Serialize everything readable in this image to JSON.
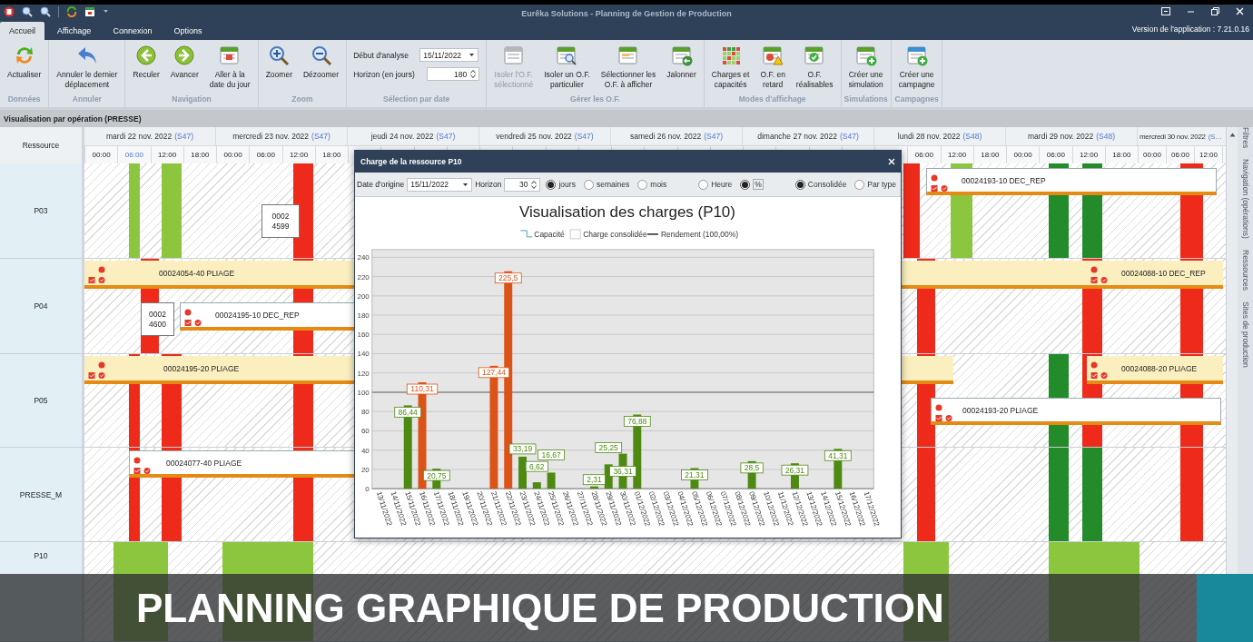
{
  "window": {
    "title": "Eurêka Solutions - Planning de Gestion de Production"
  },
  "tabs": [
    {
      "label": "Accueil",
      "selected": true
    },
    {
      "label": "Affichage",
      "selected": false
    },
    {
      "label": "Connexion",
      "selected": false
    },
    {
      "label": "Options",
      "selected": false
    }
  ],
  "version": "Version de l'application : 7.21.0.16",
  "ribbon": {
    "groups": [
      {
        "title": "Données",
        "buttons": [
          {
            "label": "Actualiser",
            "disabled": false
          }
        ]
      },
      {
        "title": "Annuler",
        "buttons": [
          {
            "label": "Annuler le dernier\ndéplacement",
            "disabled": false
          }
        ]
      },
      {
        "title": "Navigation",
        "buttons": [
          {
            "label": "Reculer",
            "disabled": false
          },
          {
            "label": "Avancer",
            "disabled": false
          },
          {
            "label": "Aller à la\ndate du jour",
            "disabled": false
          }
        ]
      },
      {
        "title": "Zoom",
        "buttons": [
          {
            "label": "Zoomer",
            "disabled": false
          },
          {
            "label": "Dézoomer",
            "disabled": false
          }
        ]
      },
      {
        "title": "Sélection par date",
        "fields": [
          {
            "label": "Début d'analyse",
            "value": "15/11/2022",
            "kind": "date"
          },
          {
            "label": "Horizon (en jours)",
            "value": "180",
            "kind": "spin"
          }
        ]
      },
      {
        "title": "Gérer les O.F.",
        "buttons": [
          {
            "label": "Isoler l'O.F.\nsélectionné",
            "disabled": true
          },
          {
            "label": "Isoler un O.F.\nparticulier",
            "disabled": false
          },
          {
            "label": "Sélectionner les\nO.F. à afficher",
            "disabled": false
          },
          {
            "label": "Jalonner",
            "disabled": false
          }
        ]
      },
      {
        "title": "Modes d'affichage",
        "buttons": [
          {
            "label": "Charges et\ncapacités",
            "disabled": false
          },
          {
            "label": "O.F. en\nretard",
            "disabled": false
          },
          {
            "label": "O.F.\nréalisables",
            "disabled": false
          }
        ]
      },
      {
        "title": "Simulations",
        "buttons": [
          {
            "label": "Créer une\nsimulation",
            "disabled": false
          }
        ]
      },
      {
        "title": "Campagnes",
        "buttons": [
          {
            "label": "Créer une\ncampagne",
            "disabled": false
          }
        ]
      }
    ]
  },
  "section_title": "Visualisation par opération (PRESSE)",
  "gantt": {
    "resource_header": "Ressource",
    "days": [
      {
        "date": "mardi 22 nov. 2022",
        "week": "(S47)",
        "hours": [
          "00:00",
          "06:00",
          "12:00",
          "18:00"
        ]
      },
      {
        "date": "mercredi 23 nov. 2022",
        "week": "(S47)",
        "hours": [
          "00:00",
          "06:00",
          "12:00",
          "18:00"
        ]
      },
      {
        "date": "jeudi 24 nov. 2022",
        "week": "(S47)"
      },
      {
        "date": "vendredi 25 nov. 2022",
        "week": "(S47)"
      },
      {
        "date": "samedi 26 nov. 2022",
        "week": "(S47)"
      },
      {
        "date": "dimanche 27 nov. 2022",
        "week": "(S47)"
      },
      {
        "date": "lundi 28 nov. 2022",
        "week": "(S48)",
        "hours": [
          "06:00",
          "12:00",
          "18:00"
        ]
      },
      {
        "date": "mardi 29 nov. 2022",
        "week": "(S48)",
        "hours": [
          "00:00",
          "06:00",
          "12:00",
          "18:00"
        ]
      },
      {
        "date": "mercredi 30 nov. 2022",
        "week": "(S…",
        "hours": [
          "00:00",
          "06:00",
          "12:00"
        ]
      }
    ],
    "rows": [
      {
        "name": "P03",
        "operations": [
          {
            "label": "0002 4599"
          },
          {
            "label": "00024193-10 DEC_REP"
          }
        ]
      },
      {
        "name": "P04",
        "operations": [
          {
            "label": "00024054-40 PLIAGE"
          },
          {
            "label": "00024088-10 DEC_REP"
          },
          {
            "label": "0002 4600"
          },
          {
            "label": "00024195-10 DEC_REP"
          }
        ]
      },
      {
        "name": "P05",
        "operations": [
          {
            "label": "00024195-20 PLIAGE"
          },
          {
            "label": "00024088-20 PLIAGE"
          },
          {
            "label": "00024193-20 PLIAGE"
          }
        ]
      },
      {
        "name": "PRESSE_M",
        "operations": [
          {
            "label": "00024077-40 PLIAGE"
          }
        ]
      },
      {
        "name": "P10"
      }
    ]
  },
  "side_tabs": [
    "Filtres",
    "Navigation (opérations)",
    "Ressources",
    "Sites de production"
  ],
  "dialog": {
    "title": "Charge de la ressource P10",
    "origin": {
      "label": "Date d'origine",
      "value": "15/11/2022"
    },
    "horizon": {
      "label": "Horizon",
      "value": "30"
    },
    "period_options": [
      {
        "label": "jours",
        "selected": true
      },
      {
        "label": "semaines",
        "selected": false
      },
      {
        "label": "mois",
        "selected": false
      }
    ],
    "unit_options": [
      {
        "label": "Heure",
        "selected": false
      },
      {
        "label": "%",
        "selected": true
      }
    ],
    "mode_options": [
      {
        "label": "Consolidée",
        "selected": true
      },
      {
        "label": "Par type",
        "selected": false
      }
    ],
    "legend": [
      {
        "label": "Capacité",
        "kind": "step"
      },
      {
        "kind": "series"
      },
      {
        "label": "Rendement (100,00%)",
        "kind": "line"
      }
    ],
    "chart_data": {
      "type": "bar",
      "title": "Visualisation des charges (P10)",
      "categories": [
        "13/11/2022",
        "14/11/2022",
        "15/11/2022",
        "16/11/2022",
        "17/11/2022",
        "18/11/2022",
        "19/11/2022",
        "20/11/2022",
        "21/11/2022",
        "22/11/2022",
        "23/11/2022",
        "24/11/2022",
        "25/11/2022",
        "26/11/2022",
        "27/11/2022",
        "28/11/2022",
        "29/11/2022",
        "30/11/2022",
        "01/12/2022",
        "02/12/2022",
        "03/12/2022",
        "04/12/2022",
        "05/12/2022",
        "06/12/2022",
        "07/12/2022",
        "08/12/2022",
        "09/12/2022",
        "10/12/2022",
        "11/12/2022",
        "12/12/2022",
        "13/12/2022",
        "14/12/2022",
        "15/12/2022",
        "16/12/2022",
        "17/12/2022"
      ],
      "series": [
        {
          "name": "Charge consolidée",
          "color": "#4e8a12",
          "colors": [
            null,
            null,
            null,
            "#dc5318",
            null,
            null,
            null,
            null,
            "#dc5318",
            "#dc5318",
            null,
            null,
            null,
            null,
            null,
            null,
            null,
            null,
            null,
            null,
            null,
            null,
            null,
            null,
            null,
            null,
            null,
            null,
            null,
            null,
            null,
            null,
            null,
            null,
            null
          ],
          "values": [
            null,
            null,
            86.44,
            110.31,
            20.75,
            null,
            null,
            null,
            127.44,
            225.5,
            33.19,
            6.62,
            16.67,
            null,
            null,
            2.31,
            25.25,
            36.31,
            76.88,
            null,
            null,
            null,
            21.31,
            null,
            null,
            null,
            28.5,
            null,
            null,
            26.31,
            null,
            null,
            41.31,
            null,
            null
          ],
          "value_labels": [
            null,
            null,
            "86,44",
            "110,31",
            "20,75",
            null,
            null,
            null,
            "127,44",
            "225,5",
            "33,19",
            "6,62",
            "16,67",
            null,
            null,
            "2,31",
            "25,25",
            "36,31",
            "76,88",
            null,
            null,
            null,
            "21,31",
            null,
            null,
            null,
            "28,5",
            null,
            null,
            "26,31",
            null,
            null,
            "41,31",
            null,
            null
          ]
        }
      ],
      "ylim": [
        0,
        248
      ],
      "yticks": [
        0,
        20,
        40,
        60,
        80,
        100,
        120,
        140,
        160,
        180,
        200,
        220,
        240
      ],
      "grid": true,
      "ref_lines": [
        {
          "value": 100,
          "axis": "y",
          "color": "#666666"
        }
      ]
    }
  },
  "caption": "PLANNING GRAPHIQUE DE PRODUCTION"
}
